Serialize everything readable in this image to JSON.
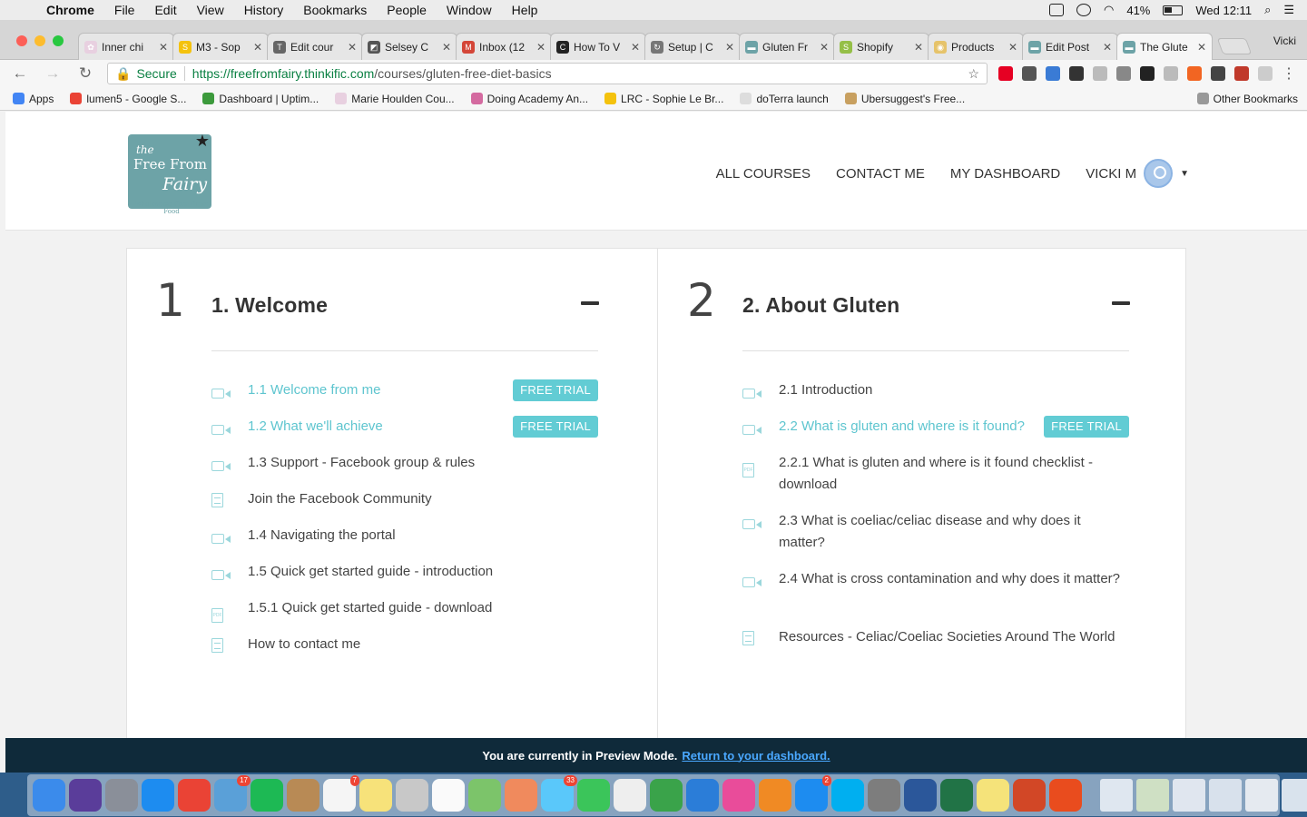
{
  "menubar": {
    "app": "Chrome",
    "items": [
      "File",
      "Edit",
      "View",
      "History",
      "Bookmarks",
      "People",
      "Window",
      "Help"
    ],
    "battery": "41%",
    "clock": "Wed 12:11"
  },
  "browser": {
    "tabs": [
      {
        "title": "Inner chi",
        "color": "#e8d0e0",
        "glyph": "✿"
      },
      {
        "title": "M3 - Sop",
        "color": "#f4c20d",
        "glyph": "S"
      },
      {
        "title": "Edit cour",
        "color": "#666666",
        "glyph": "T"
      },
      {
        "title": "Selsey C",
        "color": "#555555",
        "glyph": "◩"
      },
      {
        "title": "Inbox (12",
        "color": "#d44638",
        "glyph": "M"
      },
      {
        "title": "How To V",
        "color": "#222222",
        "glyph": "C"
      },
      {
        "title": "Setup | C",
        "color": "#777777",
        "glyph": "↻"
      },
      {
        "title": "Gluten Fr",
        "color": "#6da3a7",
        "glyph": "▬"
      },
      {
        "title": "Shopify",
        "color": "#95bf47",
        "glyph": "S"
      },
      {
        "title": "Products",
        "color": "#e6c36a",
        "glyph": "◉"
      },
      {
        "title": "Edit Post",
        "color": "#6da3a7",
        "glyph": "▬"
      },
      {
        "title": "The Glute",
        "color": "#6da3a7",
        "glyph": "▬",
        "active": true
      }
    ],
    "profile": "Vicki",
    "secure_label": "Secure",
    "url_domain": "https://freefromfairy.thinkific.com",
    "url_path": "/courses/gluten-free-diet-basics",
    "extension_colors": [
      "#e60023",
      "#555555",
      "#3a7bd5",
      "#333333",
      "#bbbbbb",
      "#888888",
      "#222222",
      "#bbbbbb",
      "#f26522",
      "#444444",
      "#c0392b",
      "#cccccc"
    ],
    "bookmarks": [
      {
        "label": "Apps",
        "color": "#4285f4"
      },
      {
        "label": "lumen5 - Google S...",
        "color": "#ea4335"
      },
      {
        "label": "Dashboard | Uptim...",
        "color": "#3c9a3c"
      },
      {
        "label": "Marie Houlden Cou...",
        "color": "#e8d0e0"
      },
      {
        "label": "Doing Academy An...",
        "color": "#d46aa0"
      },
      {
        "label": "LRC - Sophie Le Br...",
        "color": "#f4c20d"
      },
      {
        "label": "doTerra launch",
        "color": "#dddddd"
      },
      {
        "label": "Ubersuggest's Free...",
        "color": "#c8a060"
      }
    ],
    "other_bookmarks": "Other Bookmarks"
  },
  "site": {
    "logo": {
      "line1": "the",
      "line2": "Free From",
      "line3": "Fairy",
      "tagline": "Wholesome Free From Food"
    },
    "nav": {
      "all_courses": "ALL COURSES",
      "contact": "CONTACT ME",
      "dashboard": "MY DASHBOARD",
      "user": "VICKI M"
    }
  },
  "chapters": [
    {
      "number": "1",
      "title": "1. Welcome",
      "lessons": [
        {
          "title": "1.1 Welcome from me",
          "icon": "video-icon",
          "badge": "FREE TRIAL"
        },
        {
          "title": "1.2 What we'll achieve",
          "icon": "video-icon",
          "badge": "FREE TRIAL"
        },
        {
          "title": "1.3 Support - Facebook group & rules",
          "icon": "video-icon"
        },
        {
          "title": "Join the Facebook Community",
          "icon": "text-doc-icon"
        },
        {
          "title": "1.4 Navigating the portal",
          "icon": "video-icon"
        },
        {
          "title": "1.5 Quick get started guide - introduction",
          "icon": "video-icon"
        },
        {
          "title": "1.5.1 Quick get started guide - download",
          "icon": "pdf-icon"
        },
        {
          "title": "How to contact me",
          "icon": "text-doc-icon"
        }
      ]
    },
    {
      "number": "2",
      "title": "2. About Gluten",
      "lessons": [
        {
          "title": "2.1 Introduction",
          "icon": "video-icon"
        },
        {
          "title": "2.2 What is gluten and where is it found?",
          "icon": "video-icon",
          "badge": "FREE TRIAL"
        },
        {
          "title": "2.2.1 What is gluten and where is it found checklist - download",
          "icon": "pdf-icon",
          "multi": true
        },
        {
          "title": "2.3 What is coeliac/celiac disease and why does it matter?",
          "icon": "video-icon",
          "multi": true
        },
        {
          "title": "2.4 What is cross contamination and why does it matter?",
          "icon": "video-icon",
          "multi": true
        },
        {
          "title": "Resources - Celiac/Coeliac Societies Around The World",
          "icon": "text-doc-icon",
          "multi": true
        }
      ]
    }
  ],
  "preview": {
    "message": "You are currently in Preview Mode.",
    "link": "Return to your dashboard."
  },
  "dock": {
    "apps": [
      {
        "name": "finder-icon",
        "color": "#3b8beb"
      },
      {
        "name": "siri-icon",
        "color": "#5a3d9a"
      },
      {
        "name": "launchpad-icon",
        "color": "#8a8f99"
      },
      {
        "name": "safari-icon",
        "color": "#1d8cf0"
      },
      {
        "name": "chrome-icon",
        "color": "#ea4335"
      },
      {
        "name": "mail-app-icon",
        "color": "#5aa0d8",
        "badge": "17"
      },
      {
        "name": "spotify-icon",
        "color": "#1db954"
      },
      {
        "name": "contacts-icon",
        "color": "#b88a55"
      },
      {
        "name": "calendar-icon",
        "color": "#f5f5f5",
        "badge": "7"
      },
      {
        "name": "notes-icon",
        "color": "#f7e27a"
      },
      {
        "name": "help-icon",
        "color": "#c8c8c8"
      },
      {
        "name": "reminders-icon",
        "color": "#fafafa"
      },
      {
        "name": "maps-icon",
        "color": "#7cc46a"
      },
      {
        "name": "photos-icon",
        "color": "#f08a5d"
      },
      {
        "name": "messages-icon",
        "color": "#5ac8fa",
        "badge": "33"
      },
      {
        "name": "facetime-icon",
        "color": "#3bc55a"
      },
      {
        "name": "textedit-icon",
        "color": "#eeeeee"
      },
      {
        "name": "numbers-icon",
        "color": "#3aa34a"
      },
      {
        "name": "keynote-icon",
        "color": "#2b7dd8"
      },
      {
        "name": "itunes-icon",
        "color": "#e94c9a"
      },
      {
        "name": "ibooks-icon",
        "color": "#f08a24"
      },
      {
        "name": "app-store-icon",
        "color": "#1d8cf0",
        "badge": "2"
      },
      {
        "name": "skype-icon",
        "color": "#00aff0"
      },
      {
        "name": "system-preferences-icon",
        "color": "#7d7d7d"
      },
      {
        "name": "word-icon",
        "color": "#2b579a"
      },
      {
        "name": "excel-icon",
        "color": "#217346"
      },
      {
        "name": "stickies-icon",
        "color": "#f5e37a"
      },
      {
        "name": "powerpoint-icon",
        "color": "#d24726"
      },
      {
        "name": "office-icon",
        "color": "#e94c1e"
      }
    ],
    "stack_colors": [
      "#dfe7f0",
      "#cfe0c4",
      "#e0e6ef",
      "#d8e1ec",
      "#e5eaf0",
      "#d9e3ed"
    ]
  }
}
